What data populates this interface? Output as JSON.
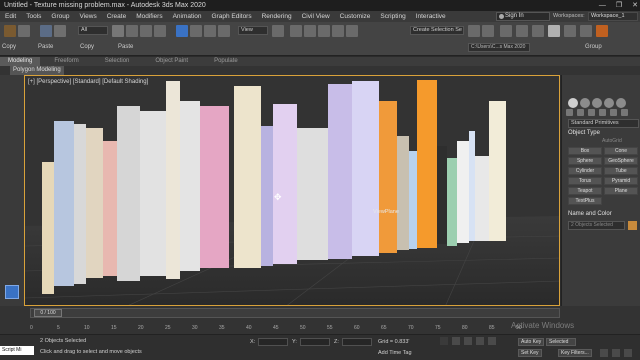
{
  "window": {
    "title": "Untitled - Texture missing problem.max - Autodesk 3ds Max 2020",
    "controls": [
      "—",
      "❐",
      "✕"
    ]
  },
  "menu": [
    "Edit",
    "Tools",
    "Group",
    "Views",
    "Create",
    "Modifiers",
    "Animation",
    "Graph Editors",
    "Rendering",
    "Civil View",
    "Customize",
    "Scripting",
    "Interactive"
  ],
  "account": {
    "signin": "Sign In",
    "workspaces_label": "Workspaces:",
    "workspace": "Workspace_1"
  },
  "toolbar": {
    "selection_filter": "All",
    "view_mode": "View",
    "named_selection": "Create Selection Se",
    "project_path": "C:\\Users\\C...s Max 2020",
    "left_labels": [
      "Copy",
      "Paste",
      "Copy",
      "Paste"
    ],
    "group_label": "Group"
  },
  "ribbon": {
    "tabs": [
      "Modeling",
      "Freeform",
      "Selection",
      "Object Paint",
      "Populate"
    ],
    "active_tab": "Modeling",
    "sub_tab": "Polygon Modeling"
  },
  "viewport": {
    "label": "[+] [Perspective] [Standard] [Default Shading]",
    "object_label": "ViewPlane"
  },
  "command_panel": {
    "category": "Standard Primitives",
    "object_type_title": "Object Type",
    "autogrid": "AutoGrid",
    "buttons": [
      "Box",
      "Cone",
      "Sphere",
      "GeoSphere",
      "Cylinder",
      "Tube",
      "Torus",
      "Pyramid",
      "Teapot",
      "Plane",
      "TextPlus"
    ],
    "name_color_title": "Name and Color",
    "objects_selected": "2 Objects Selected"
  },
  "timeline": {
    "frame": "0 / 100",
    "ticks": [
      "0",
      "5",
      "10",
      "15",
      "20",
      "25",
      "30",
      "35",
      "40",
      "45",
      "50",
      "55",
      "60",
      "65",
      "70",
      "75",
      "80",
      "85",
      "90"
    ]
  },
  "status": {
    "maxscript": "Script Mi",
    "selected": "2 Objects Selected",
    "prompt": "Click and drag to select and move objects",
    "x_label": "X:",
    "y_label": "Y:",
    "z_label": "Z:",
    "grid": "Grid = 0.833'",
    "add_time_tag": "Add Time Tag",
    "auto_key": "Auto Key",
    "selected_mode": "Selected",
    "set_key": "Set Key",
    "key_filters": "Key Filters...",
    "watermark": "Activate Windows"
  },
  "colors": {
    "accent": "#d9a23a",
    "viewport_bg": "#2a2a2a",
    "active_blue": "#3a72c4"
  }
}
